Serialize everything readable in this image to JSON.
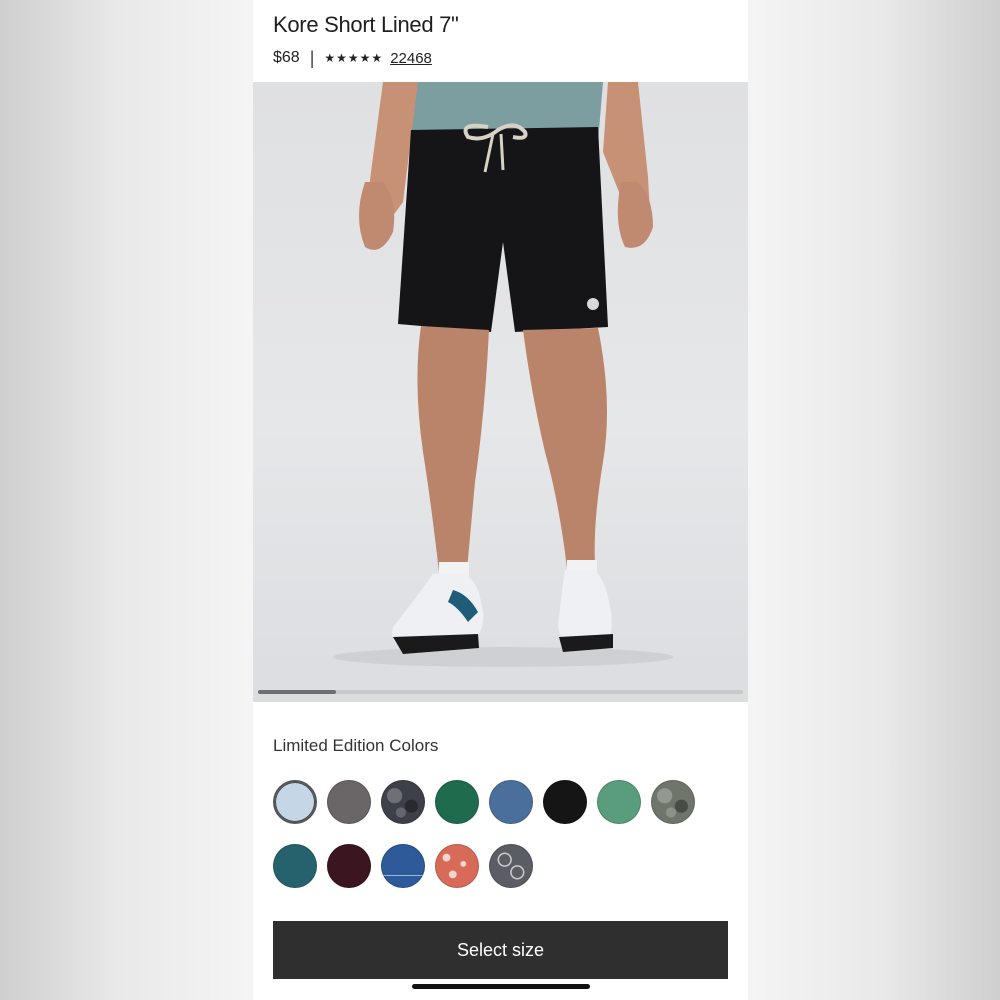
{
  "product": {
    "title": "Kore Short Lined 7\"",
    "price": "$68",
    "separator": "|",
    "stars": "★★★★★",
    "rating": 5,
    "review_count": "22468"
  },
  "gallery": {
    "image_description_icon": "product-photo",
    "progress_fraction": 0.16
  },
  "colors": {
    "heading": "Limited Edition Colors",
    "swatches": [
      {
        "name": "light-blue",
        "color": "#c5d6e6",
        "selected": true
      },
      {
        "name": "charcoal-grey",
        "color": "#6a6566"
      },
      {
        "name": "dark-camo",
        "color": "#3d4048",
        "pattern": "camo"
      },
      {
        "name": "forest-green",
        "color": "#1f6b4d"
      },
      {
        "name": "slate-blue",
        "color": "#4a6f9c"
      },
      {
        "name": "black",
        "color": "#151515"
      },
      {
        "name": "sage-green",
        "color": "#5a9d7c"
      },
      {
        "name": "olive-camo",
        "color": "#6f756b",
        "pattern": "camo"
      },
      {
        "name": "teal",
        "color": "#25626d"
      },
      {
        "name": "burgundy",
        "color": "#3b1620"
      },
      {
        "name": "royal-blue-stripe",
        "color": "#2e5a9a",
        "pattern": "stripe"
      },
      {
        "name": "coral-print",
        "color": "#d86a59",
        "pattern": "speckle"
      },
      {
        "name": "grey-floral",
        "color": "#5a5d63",
        "pattern": "floral"
      }
    ]
  },
  "cta": {
    "label": "Select size"
  }
}
